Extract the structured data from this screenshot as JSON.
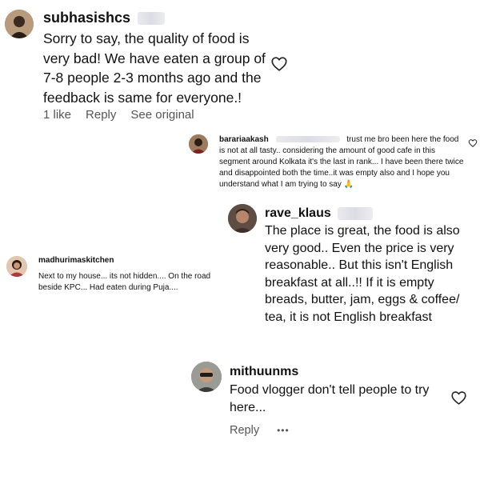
{
  "comments": [
    {
      "username": "subhasishcs",
      "text": "Sorry to say, the quality of food is very bad! We have eaten a group of 7-8 people 2-3 months ago and the feedback is same for everyone.!",
      "likes": "1 like",
      "reply": "Reply",
      "see_original": "See original"
    },
    {
      "username": "barariaakash",
      "text": "trust me bro been here the food is not at all tasty.. considering the amount of good cafe in this segment around Kolkata it's the last in rank... I have been there twice and disappointed both the time..it was empty also and I hope you understand what I am trying to say 🙏"
    },
    {
      "username": "rave_klaus",
      "text": "The place is great, the food is also very good.. Even the price is very reasonable.. But this isn't English breakfast at all..!! If it is empty breads, butter, jam, eggs & coffee/ tea, it is not English breakfast"
    },
    {
      "username": "madhurimaskitchen",
      "text": "Next to my house... its not hidden.... On the road beside KPC... Had eaten during Puja...."
    },
    {
      "username": "mithuunms",
      "text": "Food vlogger don't tell people to try here...",
      "reply": "Reply",
      "more": "•••"
    }
  ],
  "icons": {
    "heart": "heart-outline-icon",
    "more": "more-dots-icon"
  },
  "colors": {
    "text": "#111111",
    "secondary": "#555555",
    "background": "#ffffff"
  }
}
